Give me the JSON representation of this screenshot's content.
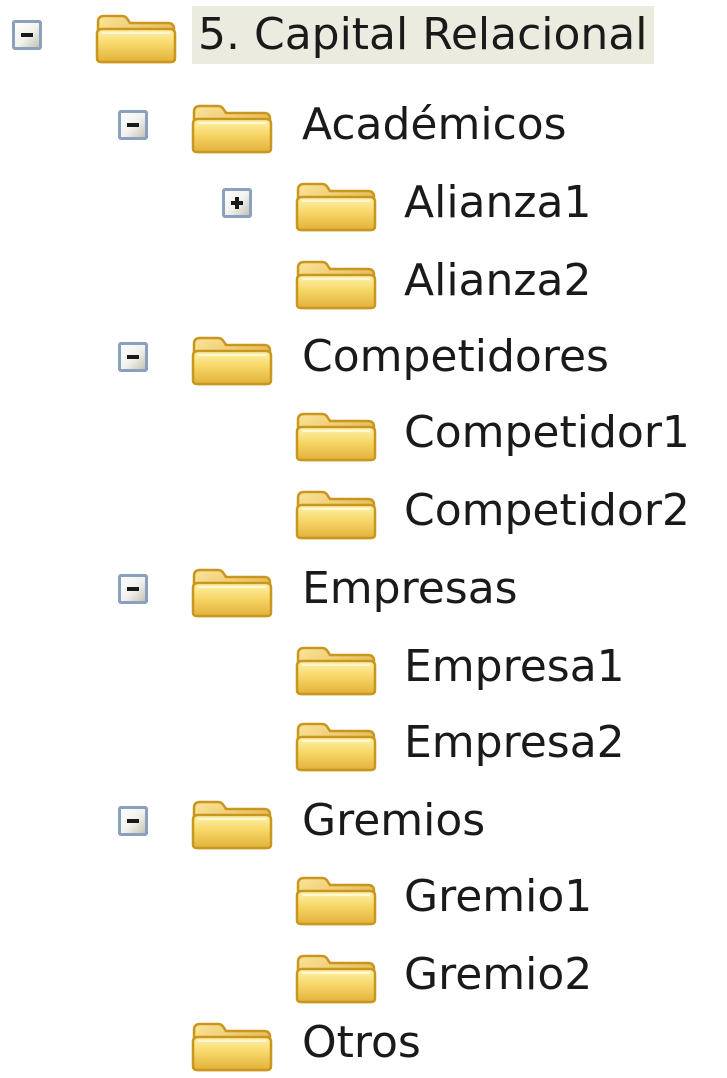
{
  "tree": {
    "root": {
      "label": "5. Capital Relacional",
      "state": "expanded",
      "selected": true
    },
    "academicos": {
      "label": "Académicos",
      "state": "expanded"
    },
    "alianza1": {
      "label": "Alianza1",
      "state": "collapsed"
    },
    "alianza2": {
      "label": "Alianza2"
    },
    "competidores": {
      "label": "Competidores",
      "state": "expanded"
    },
    "competidor1": {
      "label": "Competidor1"
    },
    "competidor2": {
      "label": "Competidor2"
    },
    "empresas": {
      "label": "Empresas",
      "state": "expanded"
    },
    "empresa1": {
      "label": "Empresa1"
    },
    "empresa2": {
      "label": "Empresa2"
    },
    "gremios": {
      "label": "Gremios",
      "state": "expanded"
    },
    "gremio1": {
      "label": "Gremio1"
    },
    "gremio2": {
      "label": "Gremio2"
    },
    "otros": {
      "label": "Otros"
    }
  },
  "icons": {
    "expanded": "minus-box-icon",
    "collapsed": "plus-box-icon",
    "folder": "folder-icon"
  },
  "colors": {
    "selection_background": "#ecebe0",
    "toggle_border": "#8aa0bf",
    "folder_body": "#f7d768",
    "folder_outline": "#c9961e"
  }
}
